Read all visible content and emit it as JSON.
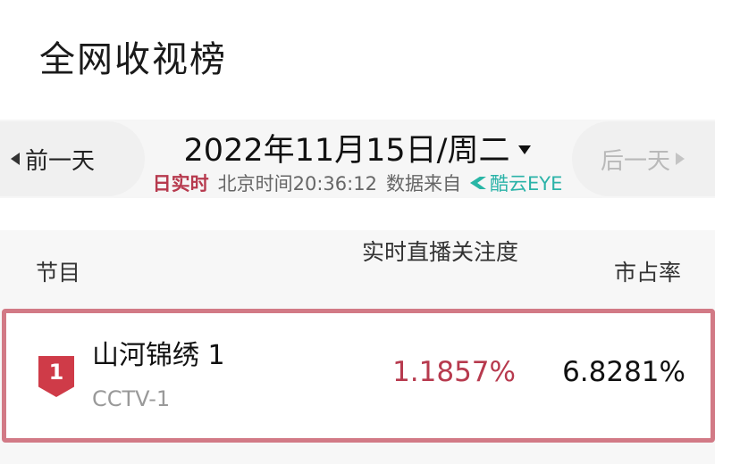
{
  "page": {
    "title": "全网收视榜"
  },
  "date_nav": {
    "prev_label": "前一天",
    "next_label": "后一天",
    "date_text": "2022年11月15日/周二",
    "realtime_label": "日实时",
    "time_text": "北京时间20:36:12",
    "source_prefix": "数据来自",
    "source_name": "酷云EYE"
  },
  "table": {
    "headers": {
      "program": "节目",
      "attention": "实时直播关注度",
      "share": "市占率"
    },
    "rows": [
      {
        "rank": "1",
        "title": "山河锦绣 1",
        "channel": "CCTV-1",
        "attention": "1.1857%",
        "share": "6.8281%"
      }
    ]
  },
  "colors": {
    "accent": "#b73a4e",
    "rank_badge": "#cf3b48",
    "row_highlight_border": "#d27a86",
    "source_logo": "#29b6a6"
  },
  "icons": {
    "prev": "caret-left-icon",
    "next": "caret-right-icon",
    "date_dropdown": "caret-down-icon",
    "source_logo": "kuyun-logo-icon"
  }
}
